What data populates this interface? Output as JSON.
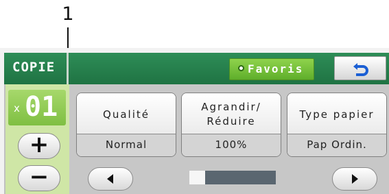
{
  "annotation": {
    "number": "1"
  },
  "header": {
    "title": "COPIE",
    "favorites_label": "Favoris",
    "back_icon": "return-arrow-icon"
  },
  "copies": {
    "prefix": "x",
    "count": "01",
    "plus_label": "+",
    "minus_label": "−"
  },
  "settings": [
    {
      "label": "Qualité",
      "value": "Normal"
    },
    {
      "label": "Agrandir/ Réduire",
      "value": "100%"
    },
    {
      "label": "Type papier",
      "value": "Pap Ordin."
    }
  ],
  "navigation": {
    "left_icon": "left-triangle-icon",
    "right_icon": "right-triangle-icon",
    "scroll_position": 0.18
  },
  "colors": {
    "header_green": "#1f7343",
    "favorites_green": "#7cc43f",
    "panel_green": "#cfe6a6",
    "back_arrow_blue": "#1b5fd4",
    "scroll_track": "#5a6670"
  }
}
